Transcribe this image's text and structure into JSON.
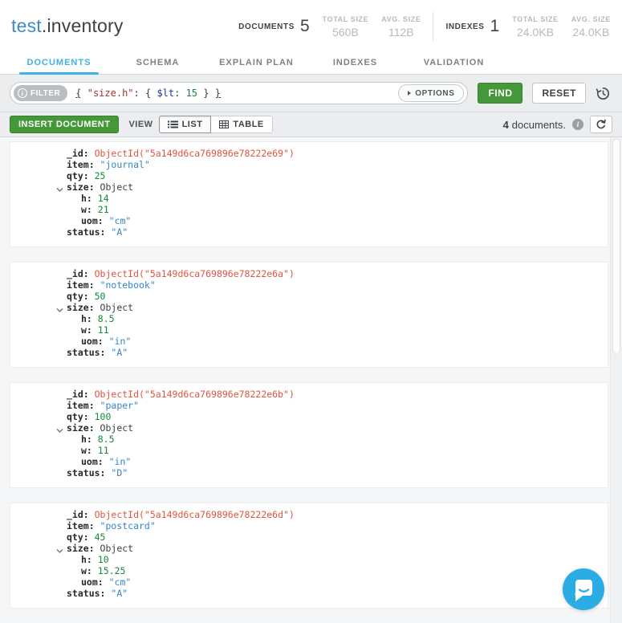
{
  "colors": {
    "accent_blue": "#3fb0e8",
    "title_blue": "#3f8ac9",
    "button_green": "#459839",
    "value_string": "#3585ca",
    "value_number": "#15883e",
    "value_objectid": "#e0543e",
    "chat_bubble_blue": "#29ade4"
  },
  "header": {
    "db_name": "test",
    "separator": ".",
    "collection_name": "inventory",
    "stats": {
      "documents_label": "DOCUMENTS",
      "documents_count": "5",
      "documents_total_size_label": "TOTAL SIZE",
      "documents_total_size": "560B",
      "documents_avg_size_label": "AVG. SIZE",
      "documents_avg_size": "112B",
      "indexes_label": "INDEXES",
      "indexes_count": "1",
      "indexes_total_size_label": "TOTAL SIZE",
      "indexes_total_size": "24.0KB",
      "indexes_avg_size_label": "AVG. SIZE",
      "indexes_avg_size": "24.0KB"
    }
  },
  "tabs": [
    {
      "label": "DOCUMENTS",
      "active": true
    },
    {
      "label": "SCHEMA",
      "active": false
    },
    {
      "label": "EXPLAIN PLAN",
      "active": false
    },
    {
      "label": "INDEXES",
      "active": false
    },
    {
      "label": "VALIDATION",
      "active": false
    }
  ],
  "filter": {
    "badge_label": "FILTER",
    "badge_info_glyph": "i",
    "query_parts": [
      {
        "text": "{",
        "type": "brace-u"
      },
      {
        "text": " ",
        "type": "plain"
      },
      {
        "text": "\"size.h\"",
        "type": "field"
      },
      {
        "text": ": ",
        "type": "plain"
      },
      {
        "text": "{ ",
        "type": "plain"
      },
      {
        "text": "$lt",
        "type": "op"
      },
      {
        "text": ": ",
        "type": "plain"
      },
      {
        "text": "15",
        "type": "num"
      },
      {
        "text": " } ",
        "type": "plain"
      },
      {
        "text": "}",
        "type": "brace-u"
      }
    ],
    "options_label": "OPTIONS",
    "find_label": "FIND",
    "reset_label": "RESET",
    "history_icon": "recent-queries"
  },
  "toolbar": {
    "insert_label": "INSERT DOCUMENT",
    "view_label": "VIEW",
    "list_label": "LIST",
    "table_label": "TABLE",
    "documents_count": "4",
    "documents_count_suffix": "documents.",
    "info_glyph": "i",
    "refresh_icon": "refresh"
  },
  "documents": [
    {
      "fields": [
        {
          "key": "_id",
          "value": "ObjectId(\"5a149d6ca769896e78222e69\")",
          "type": "oid",
          "indent": 0
        },
        {
          "key": "item",
          "value": "\"journal\"",
          "type": "str",
          "indent": 0
        },
        {
          "key": "qty",
          "value": "25",
          "type": "num",
          "indent": 0
        },
        {
          "key": "size",
          "value": "Object",
          "type": "obj",
          "indent": 0,
          "expandable": true
        },
        {
          "key": "h",
          "value": "14",
          "type": "num",
          "indent": 1
        },
        {
          "key": "w",
          "value": "21",
          "type": "num",
          "indent": 1
        },
        {
          "key": "uom",
          "value": "\"cm\"",
          "type": "str",
          "indent": 1
        },
        {
          "key": "status",
          "value": "\"A\"",
          "type": "str",
          "indent": 0
        }
      ]
    },
    {
      "fields": [
        {
          "key": "_id",
          "value": "ObjectId(\"5a149d6ca769896e78222e6a\")",
          "type": "oid",
          "indent": 0
        },
        {
          "key": "item",
          "value": "\"notebook\"",
          "type": "str",
          "indent": 0
        },
        {
          "key": "qty",
          "value": "50",
          "type": "num",
          "indent": 0
        },
        {
          "key": "size",
          "value": "Object",
          "type": "obj",
          "indent": 0,
          "expandable": true
        },
        {
          "key": "h",
          "value": "8.5",
          "type": "num",
          "indent": 1
        },
        {
          "key": "w",
          "value": "11",
          "type": "num",
          "indent": 1
        },
        {
          "key": "uom",
          "value": "\"in\"",
          "type": "str",
          "indent": 1
        },
        {
          "key": "status",
          "value": "\"A\"",
          "type": "str",
          "indent": 0
        }
      ]
    },
    {
      "fields": [
        {
          "key": "_id",
          "value": "ObjectId(\"5a149d6ca769896e78222e6b\")",
          "type": "oid",
          "indent": 0
        },
        {
          "key": "item",
          "value": "\"paper\"",
          "type": "str",
          "indent": 0
        },
        {
          "key": "qty",
          "value": "100",
          "type": "num",
          "indent": 0
        },
        {
          "key": "size",
          "value": "Object",
          "type": "obj",
          "indent": 0,
          "expandable": true
        },
        {
          "key": "h",
          "value": "8.5",
          "type": "num",
          "indent": 1
        },
        {
          "key": "w",
          "value": "11",
          "type": "num",
          "indent": 1
        },
        {
          "key": "uom",
          "value": "\"in\"",
          "type": "str",
          "indent": 1
        },
        {
          "key": "status",
          "value": "\"D\"",
          "type": "str",
          "indent": 0
        }
      ]
    },
    {
      "fields": [
        {
          "key": "_id",
          "value": "ObjectId(\"5a149d6ca769896e78222e6d\")",
          "type": "oid",
          "indent": 0
        },
        {
          "key": "item",
          "value": "\"postcard\"",
          "type": "str",
          "indent": 0
        },
        {
          "key": "qty",
          "value": "45",
          "type": "num",
          "indent": 0
        },
        {
          "key": "size",
          "value": "Object",
          "type": "obj",
          "indent": 0,
          "expandable": true
        },
        {
          "key": "h",
          "value": "10",
          "type": "num",
          "indent": 1
        },
        {
          "key": "w",
          "value": "15.25",
          "type": "num",
          "indent": 1
        },
        {
          "key": "uom",
          "value": "\"cm\"",
          "type": "str",
          "indent": 1
        },
        {
          "key": "status",
          "value": "\"A\"",
          "type": "str",
          "indent": 0
        }
      ]
    }
  ]
}
